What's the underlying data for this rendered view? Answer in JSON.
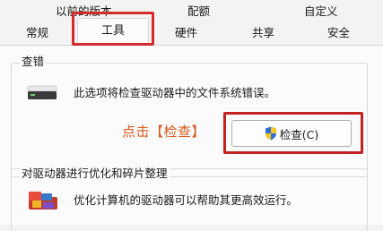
{
  "tabs_row1": [
    {
      "label": "以前的版本"
    },
    {
      "label": "配额"
    },
    {
      "label": "自定义"
    }
  ],
  "tabs_row2": [
    {
      "label": "常规"
    },
    {
      "label": "工具",
      "active": true
    },
    {
      "label": "硬件"
    },
    {
      "label": "共享"
    },
    {
      "label": "安全"
    }
  ],
  "check_section": {
    "title": "查错",
    "description": "此选项将检查驱动器中的文件系统错误。",
    "button_label": "检查(C)",
    "icon": "drive-icon"
  },
  "optimize_section": {
    "title": "对驱动器进行优化和碎片整理",
    "description": "优化计算机的驱动器可以帮助其更高效运行。",
    "icon": "defrag-icon"
  },
  "annotation": {
    "text": "点击【检查】",
    "color": "#d8581c",
    "highlight_color": "#c42222"
  }
}
